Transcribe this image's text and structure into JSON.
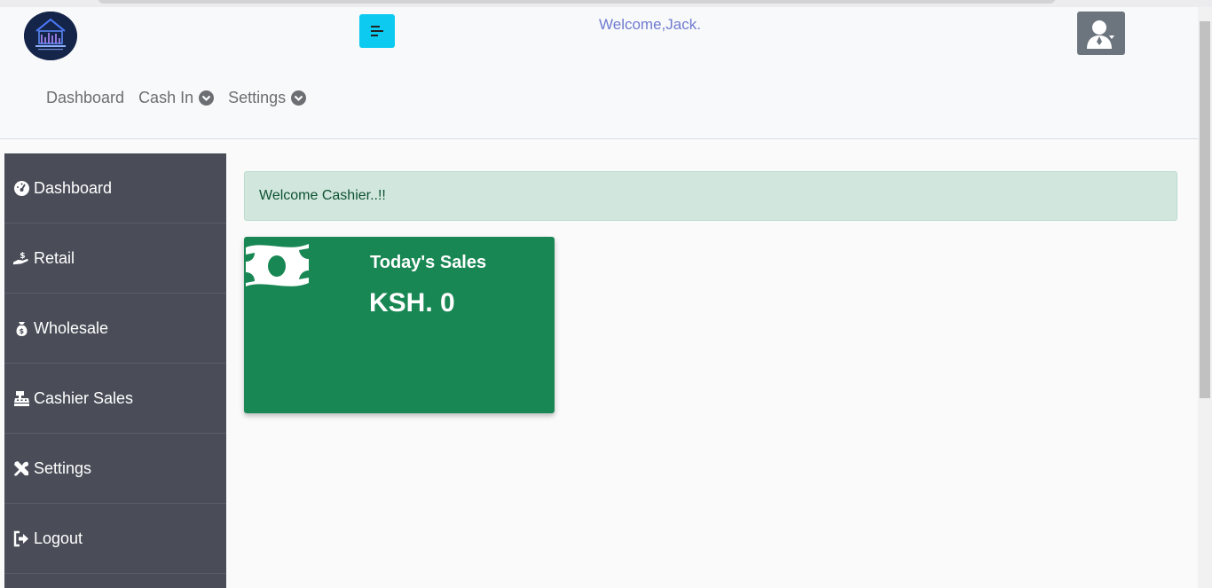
{
  "header": {
    "welcome_text": "Welcome,Jack.",
    "toggle_icon": "menu-toggle-icon",
    "avatar_icon": "user-icon",
    "accent": "#0dcaf0"
  },
  "topnav": {
    "items": [
      {
        "label": "Dashboard"
      },
      {
        "label": "Cash In"
      },
      {
        "label": "Settings"
      }
    ]
  },
  "sidebar": {
    "items": [
      {
        "label": "Dashboard",
        "icon": "tachometer-icon"
      },
      {
        "label": "Retail",
        "icon": "hand-holding-dollar-icon"
      },
      {
        "label": "Wholesale",
        "icon": "money-bag-icon"
      },
      {
        "label": "Cashier Sales",
        "icon": "cash-register-icon"
      },
      {
        "label": "Settings",
        "icon": "tools-icon"
      },
      {
        "label": "Logout",
        "icon": "sign-out-icon"
      }
    ]
  },
  "alert": {
    "text": "Welcome Cashier..!!",
    "color": "#d1e7dd"
  },
  "sales_card": {
    "title": "Today's Sales",
    "amount": "KSH. 0",
    "icon": "money-bill-icon",
    "color": "#198754"
  }
}
